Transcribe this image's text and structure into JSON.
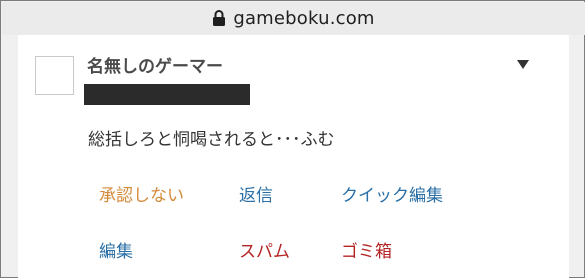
{
  "browser": {
    "url": "gameboku.com",
    "lock_icon": "lock-icon"
  },
  "comment": {
    "author": "名無しのゲーマー",
    "text": "総括しろと恫喝されると･･･ふむ",
    "menu_icon": "caret-down-icon"
  },
  "actions": {
    "approve": "承認しない",
    "reply": "返信",
    "quick_edit": "クイック編集",
    "edit": "編集",
    "spam": "スパム",
    "trash": "ゴミ箱"
  },
  "colors": {
    "approve": "#d38a3a",
    "link": "#2a6fa6",
    "danger": "#b42424"
  }
}
